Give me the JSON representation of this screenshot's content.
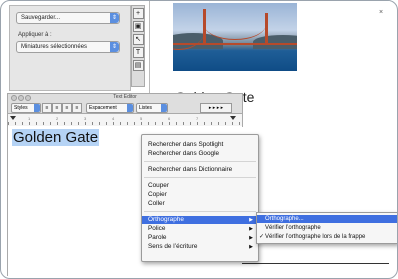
{
  "inspector": {
    "save_select": "Sauvegarder...",
    "apply_label": "Appliquer à :",
    "apply_select": "Miniatures sélectionnées"
  },
  "tools": {
    "icons": [
      "add-icon",
      "frame-icon",
      "pointer-icon",
      "text-tool-icon",
      "image-tool-icon"
    ],
    "text_tool_glyph": "T"
  },
  "document": {
    "caption": "Golden Gate",
    "close_glyph": "×"
  },
  "editor": {
    "title": "Text Editor",
    "styles_select": "Styles",
    "spacing_select": "Espacement",
    "lists_select": "Listes",
    "ruler_numbers": [
      "0",
      "1",
      "2",
      "3",
      "4",
      "5",
      "6",
      "7"
    ],
    "text": "Golden Gate"
  },
  "context_menu": {
    "items": [
      "Rechercher dans Spotlight",
      "Rechercher dans Google",
      "Rechercher dans Dictionnaire",
      "Couper",
      "Copier",
      "Coller",
      "Orthographe",
      "Police",
      "Parole",
      "Sens de l’écriture"
    ],
    "submenu_arrow": "▶"
  },
  "spelling_submenu": {
    "items": [
      "Orthographe...",
      "Vérifier l’orthographe",
      "Vérifier l’orthographe lors de la frappe"
    ],
    "checkmark": "✓"
  },
  "colors": {
    "highlight": "#3f6fe0",
    "selection": "#b5d3f5",
    "select_arrow": "#5b8fe0"
  }
}
